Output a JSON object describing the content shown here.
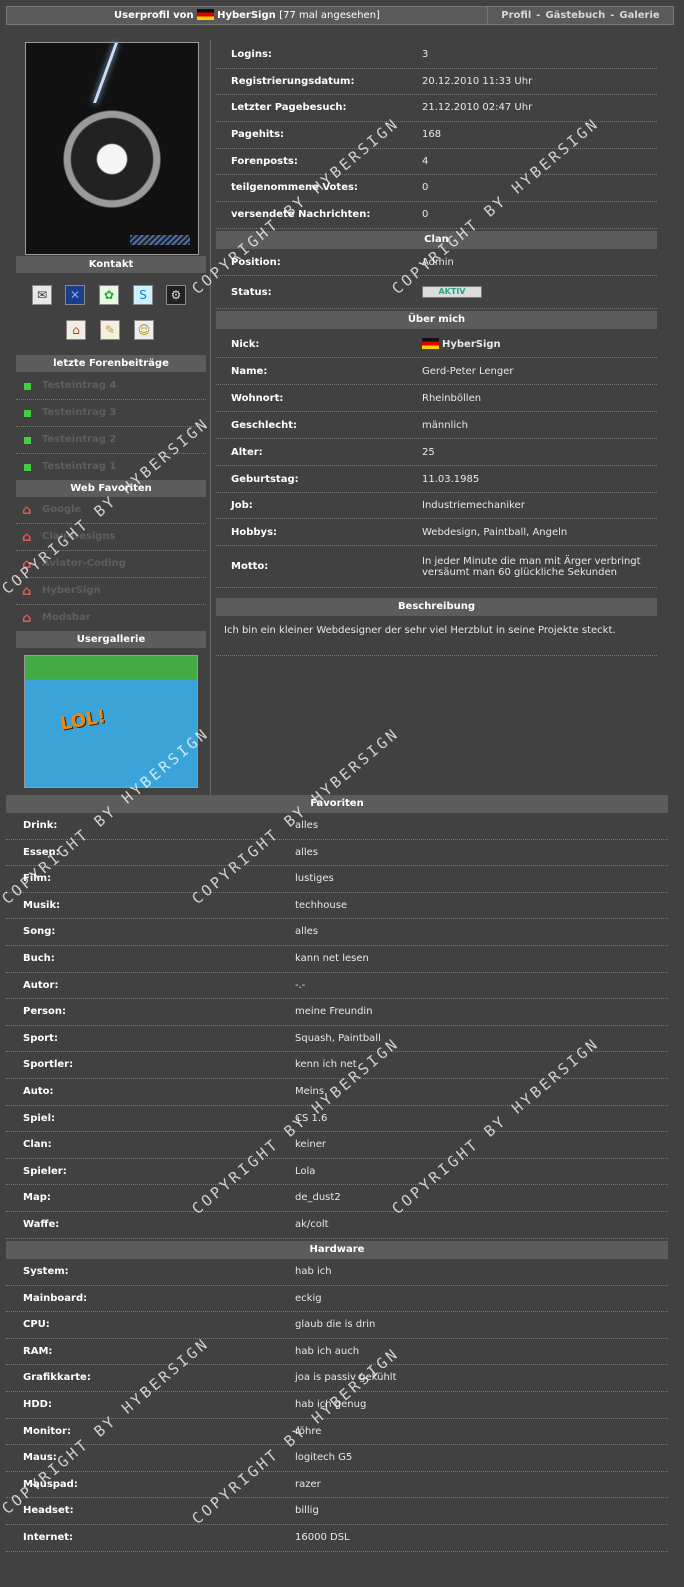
{
  "header": {
    "title_prefix": "Userprofil von",
    "username": "HyberSign",
    "views": "[77 mal angesehen]",
    "nav": [
      "Profil",
      "Gästebuch",
      "Galerie"
    ],
    "nav_sep": "-"
  },
  "sidebar": {
    "contact_title": "Kontakt",
    "contact_icons": [
      "mail-icon",
      "xfire-icon",
      "icq-icon",
      "skype-icon",
      "steam-icon",
      "homepage-icon",
      "guestbook-icon",
      "add-friend-icon"
    ],
    "posts_title": "letzte Forenbeiträge",
    "posts": [
      "Testeintrag 4",
      "Testeintrag 3",
      "Testeintrag 2",
      "Testeintrag 1"
    ],
    "favorites_title": "Web Favoriten",
    "favorites": [
      "Google",
      "Clan-Designs",
      "Aviator-Coding",
      "HyberSign",
      "Modsbar"
    ],
    "gallery_title": "Usergallerie",
    "gallery_caption": "LOL!"
  },
  "stats": [
    {
      "label": "Logins:",
      "value": "3"
    },
    {
      "label": "Registrierungsdatum:",
      "value": "20.12.2010 11:33 Uhr"
    },
    {
      "label": "Letzter Pagebesuch:",
      "value": "21.12.2010 02:47 Uhr"
    },
    {
      "label": "Pagehits:",
      "value": "168"
    },
    {
      "label": "Forenposts:",
      "value": "4"
    },
    {
      "label": "teilgenommene Votes:",
      "value": "0"
    },
    {
      "label": "versendete Nachrichten:",
      "value": "0"
    }
  ],
  "clan": {
    "title": "Clan",
    "position_label": "Position:",
    "position_value": "Admin",
    "status_label": "Status:",
    "status_value": "AKTIV"
  },
  "about": {
    "title": "Über mich",
    "rows": [
      {
        "label": "Nick:",
        "value": "HyberSign"
      },
      {
        "label": "Name:",
        "value": "Gerd-Peter Lenger"
      },
      {
        "label": "Wohnort:",
        "value": "Rheinböllen"
      },
      {
        "label": "Geschlecht:",
        "value": "männlich"
      },
      {
        "label": "Alter:",
        "value": "25"
      },
      {
        "label": "Geburtstag:",
        "value": "11.03.1985"
      },
      {
        "label": "Job:",
        "value": "Industriemechaniker"
      },
      {
        "label": "Hobbys:",
        "value": "Webdesign, Paintball, Angeln"
      },
      {
        "label": "Motto:",
        "value": "In jeder Minute die man mit Ärger verbringt versäumt man 60 glückliche Sekunden"
      }
    ]
  },
  "description": {
    "title": "Beschreibung",
    "text": "Ich bin ein kleiner Webdesigner der sehr viel Herzblut in seine Projekte steckt."
  },
  "favorites": {
    "title": "Favoriten",
    "rows": [
      {
        "label": "Drink:",
        "value": "alles"
      },
      {
        "label": "Essen:",
        "value": "alles"
      },
      {
        "label": "Film:",
        "value": "lustiges"
      },
      {
        "label": "Musik:",
        "value": "techhouse"
      },
      {
        "label": "Song:",
        "value": "alles"
      },
      {
        "label": "Buch:",
        "value": "kann net lesen"
      },
      {
        "label": "Autor:",
        "value": "-.-"
      },
      {
        "label": "Person:",
        "value": "meine Freundin"
      },
      {
        "label": "Sport:",
        "value": "Squash, Paintball"
      },
      {
        "label": "Sportler:",
        "value": "kenn ich net"
      },
      {
        "label": "Auto:",
        "value": "Meins"
      },
      {
        "label": "Spiel:",
        "value": "CS 1.6"
      },
      {
        "label": "Clan:",
        "value": "keiner"
      },
      {
        "label": "Spieler:",
        "value": "Lola"
      },
      {
        "label": "Map:",
        "value": "de_dust2"
      },
      {
        "label": "Waffe:",
        "value": "ak/colt"
      }
    ]
  },
  "hardware": {
    "title": "Hardware",
    "rows": [
      {
        "label": "System:",
        "value": "hab ich"
      },
      {
        "label": "Mainboard:",
        "value": "eckig"
      },
      {
        "label": "CPU:",
        "value": "glaub die is drin"
      },
      {
        "label": "RAM:",
        "value": "hab ich auch"
      },
      {
        "label": "Grafikkarte:",
        "value": "joa is passiv gekühlt"
      },
      {
        "label": "HDD:",
        "value": "hab ich genug"
      },
      {
        "label": "Monitor:",
        "value": "röhre"
      },
      {
        "label": "Maus:",
        "value": "logitech G5"
      },
      {
        "label": "Mauspad:",
        "value": "razer"
      },
      {
        "label": "Headset:",
        "value": "billig"
      },
      {
        "label": "Internet:",
        "value": "16000 DSL"
      }
    ]
  },
  "watermark": "COPYRIGHT BY HYBERSIGN"
}
